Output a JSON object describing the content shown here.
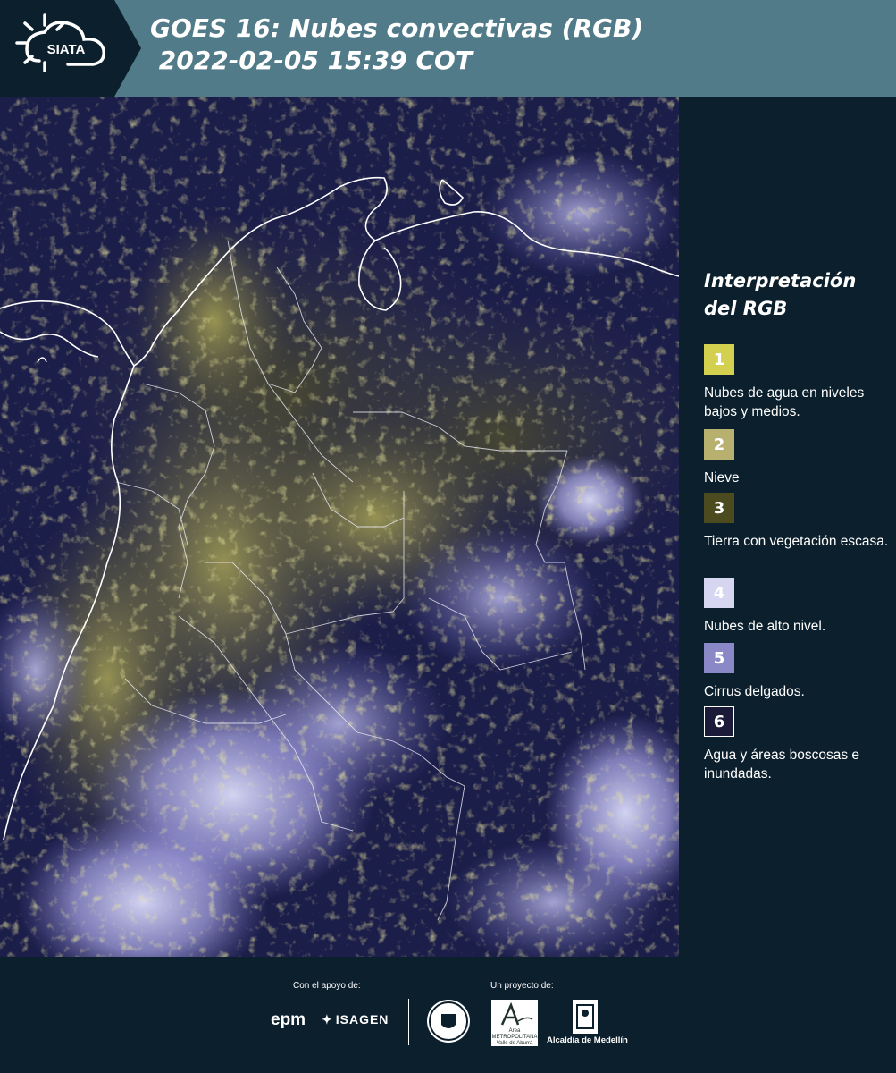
{
  "header": {
    "logo_text": "SIATA",
    "title": "GOES 16: Nubes convectivas (RGB)\n 2022-02-05 15:39 COT"
  },
  "legend": {
    "title": "Interpretación del RGB",
    "items": [
      {
        "number": "1",
        "color": "#d3cf4f",
        "text": "Nubes de agua en niveles bajos y medios."
      },
      {
        "number": "2",
        "color": "#b8b06e",
        "text": "Nieve"
      },
      {
        "number": "3",
        "color": "#4b4b1f",
        "text": "Tierra con vegetación escasa."
      },
      {
        "number": "4",
        "color": "#d6d6f0",
        "text": "Nubes de alto nivel."
      },
      {
        "number": "5",
        "color": "#8b88c8",
        "text": "Cirrus delgados."
      },
      {
        "number": "6",
        "color": "#1b1a38",
        "text": "Agua y áreas boscosas e inundadas."
      }
    ]
  },
  "footer": {
    "support_label": "Con el apoyo de:",
    "project_label": "Un proyecto de:",
    "sponsors": [
      "epm",
      "ISAGEN"
    ],
    "area_logo_text": "Área METROPOLITANA Valle de Aburrá",
    "alcaldia": "Alcaldía de Medellín"
  }
}
